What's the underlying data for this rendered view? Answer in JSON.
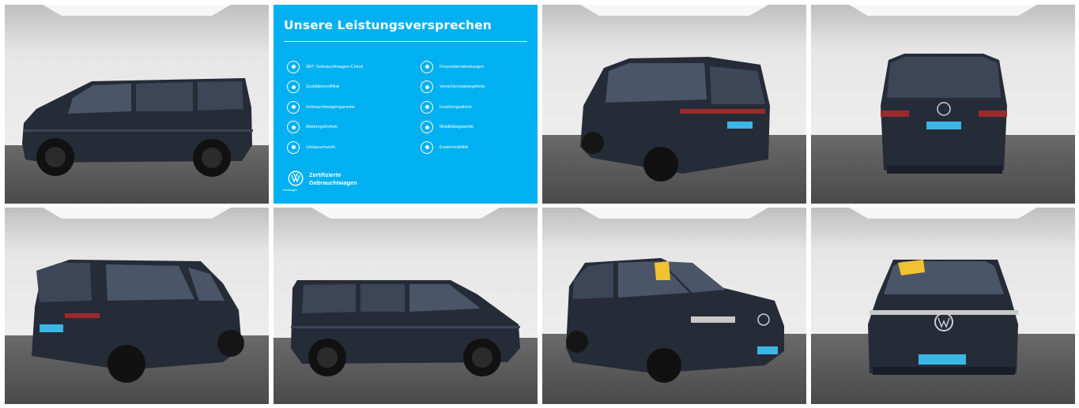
{
  "gallery": {
    "tiles": [
      {
        "kind": "photo",
        "name": "vehicle-side-left-view"
      },
      {
        "kind": "promo",
        "name": "promo-card"
      },
      {
        "kind": "photo",
        "name": "vehicle-rear-left-view"
      },
      {
        "kind": "photo",
        "name": "vehicle-rear-view"
      },
      {
        "kind": "photo",
        "name": "vehicle-rear-right-view"
      },
      {
        "kind": "photo",
        "name": "vehicle-side-right-view"
      },
      {
        "kind": "photo",
        "name": "vehicle-front-right-view"
      },
      {
        "kind": "photo",
        "name": "vehicle-front-view"
      }
    ]
  },
  "promo": {
    "title": "Unsere Leistungsversprechen",
    "left_items": [
      {
        "label": "360° Gebrauchtwagen-Check",
        "icon": "check-360-icon"
      },
      {
        "label": "Qualitätszertifikat",
        "icon": "certificate-icon"
      },
      {
        "label": "Gebrauchtwagengarantie",
        "icon": "warranty-shield-icon"
      },
      {
        "label": "Wartungsfreiheit",
        "icon": "maintenance-icon"
      },
      {
        "label": "Umtauschrecht",
        "icon": "exchange-icon"
      }
    ],
    "right_items": [
      {
        "label": "Finanzdienstleistungen",
        "icon": "finance-icon"
      },
      {
        "label": "Versicherungsangebote",
        "icon": "insurance-icon"
      },
      {
        "label": "Inzahlungnahme",
        "icon": "trade-in-icon"
      },
      {
        "label": "Mobilitätsgarantie",
        "icon": "mobility-guarantee-icon"
      },
      {
        "label": "Ersatzmobilität",
        "icon": "replacement-mobility-icon"
      }
    ],
    "vw_small": "Volkswagen",
    "cert_line1": "Zertifizierte",
    "cert_line2": "Gebrauchtwagen"
  },
  "colors": {
    "promo_bg": "#00b0f0",
    "studio_wall": "#e2e2e2",
    "studio_floor": "#585858",
    "vehicle_body": "#262b38",
    "plate": "#3ab7e6"
  }
}
